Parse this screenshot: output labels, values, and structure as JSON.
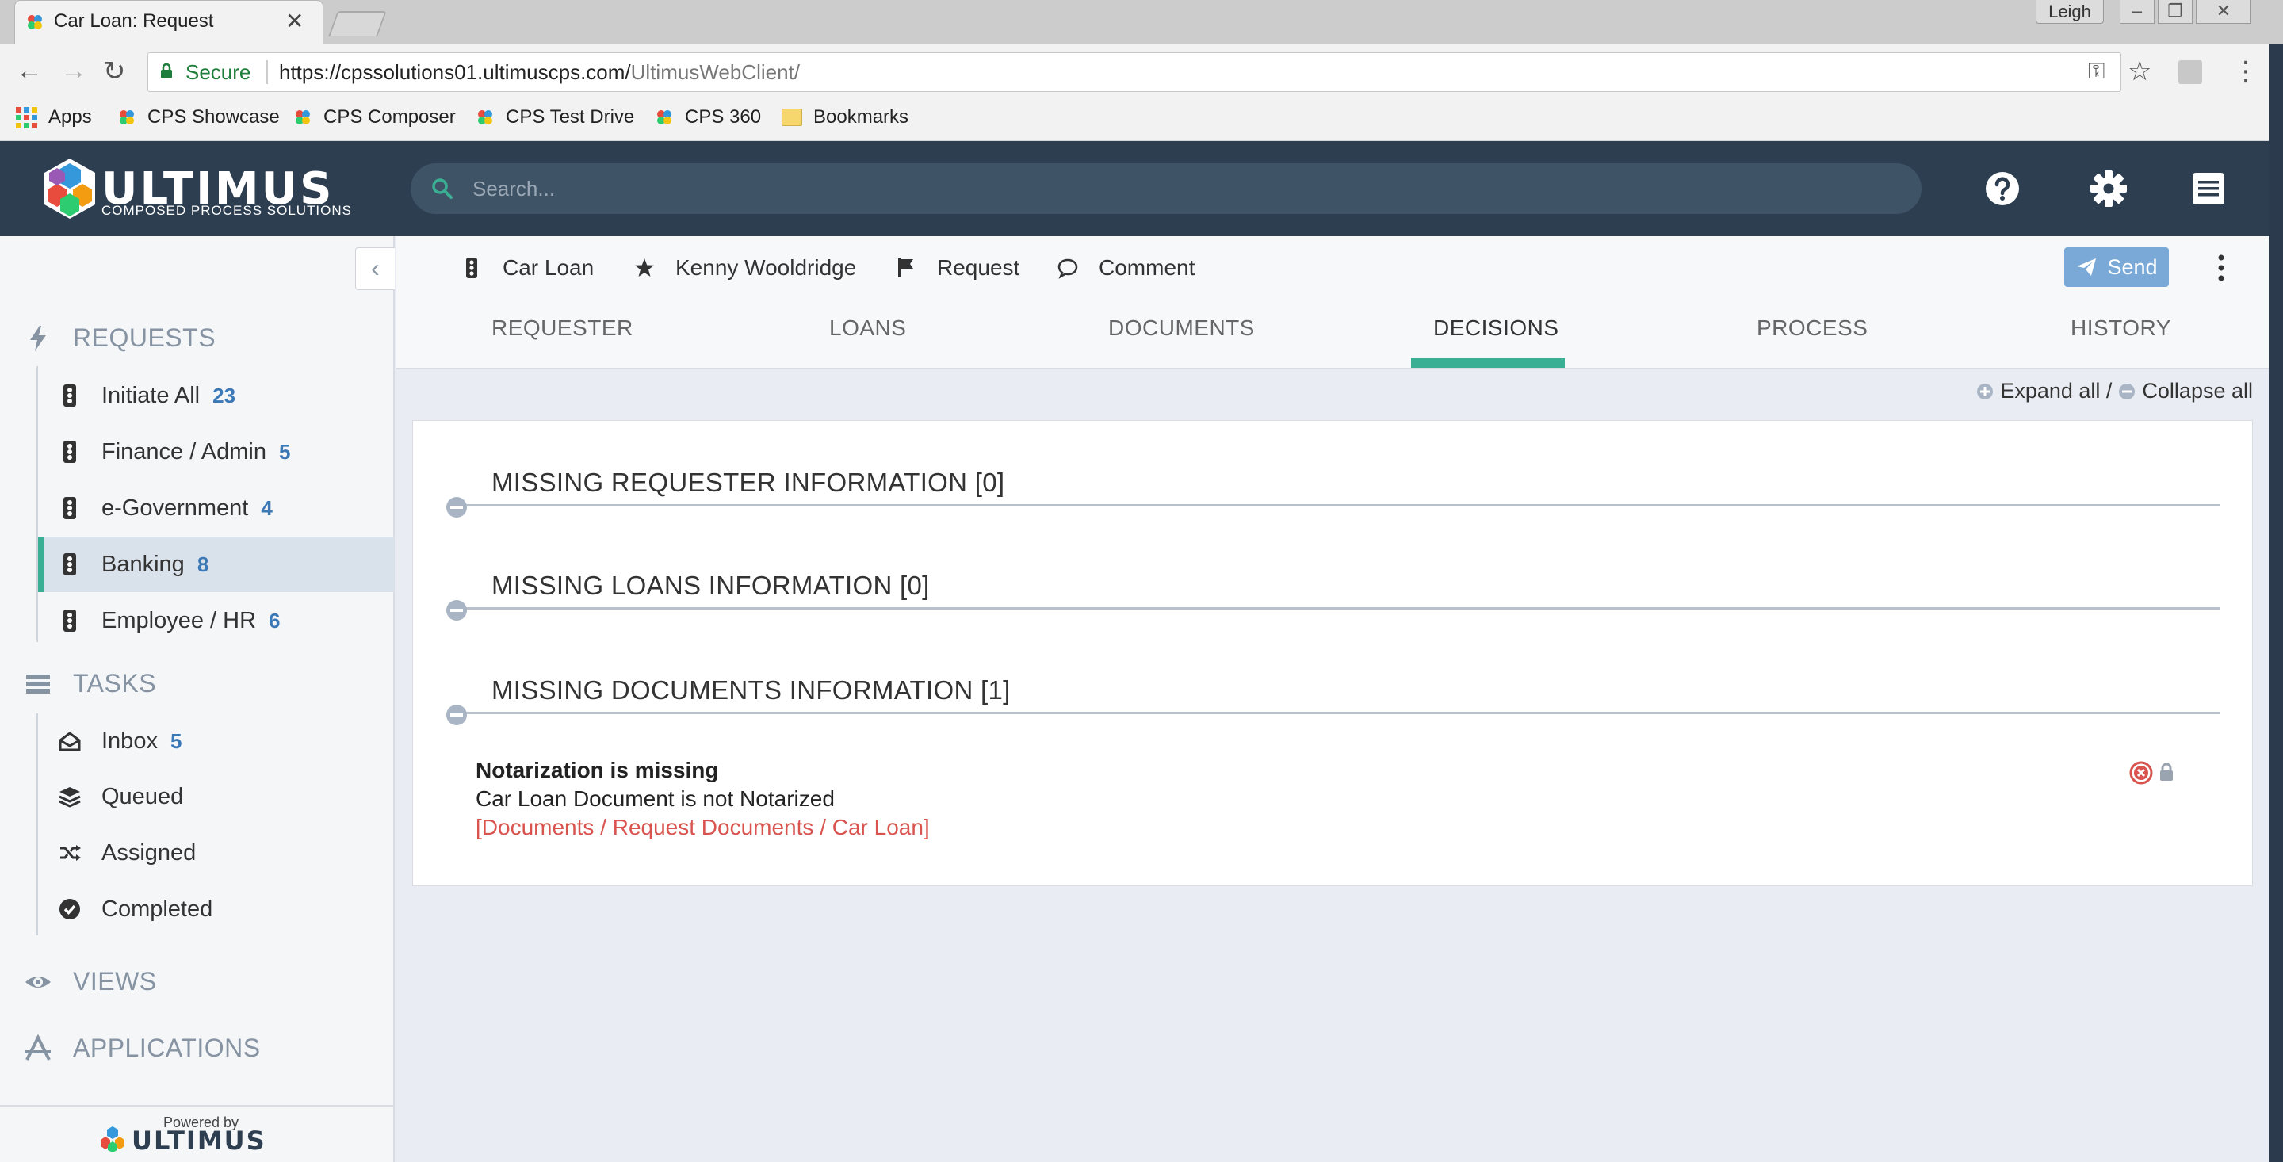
{
  "browser": {
    "tab_title": "Car Loan: Request",
    "user": "Leigh",
    "secure_label": "Secure",
    "url_host": "https://cpssolutions01.ultimuscps.com/",
    "url_path": "UltimusWebClient/",
    "bookmarks": [
      "Apps",
      "CPS Showcase",
      "CPS Composer",
      "CPS Test Drive",
      "CPS 360",
      "Bookmarks"
    ]
  },
  "header": {
    "logo_word": "ULTIMUS",
    "logo_tagline": "COMPOSED PROCESS SOLUTIONS",
    "search_placeholder": "Search..."
  },
  "sidebar": {
    "requests_label": "REQUESTS",
    "requests": [
      {
        "label": "Initiate All",
        "count": "23"
      },
      {
        "label": "Finance / Admin",
        "count": "5"
      },
      {
        "label": "e-Government",
        "count": "4"
      },
      {
        "label": "Banking",
        "count": "8"
      },
      {
        "label": "Employee / HR",
        "count": "6"
      }
    ],
    "tasks_label": "TASKS",
    "tasks": [
      {
        "label": "Inbox",
        "count": "5"
      },
      {
        "label": "Queued",
        "count": ""
      },
      {
        "label": "Assigned",
        "count": ""
      },
      {
        "label": "Completed",
        "count": ""
      }
    ],
    "views_label": "VIEWS",
    "applications_label": "APPLICATIONS",
    "powered_by": "Powered by",
    "powered_logo_word": "ULTIMUS"
  },
  "crumbs": {
    "form": "Car Loan",
    "user": "Kenny Wooldridge",
    "type": "Request",
    "comment": "Comment",
    "send": "Send"
  },
  "tabs": [
    "REQUESTER",
    "LOANS",
    "DOCUMENTS",
    "DECISIONS",
    "PROCESS",
    "HISTORY"
  ],
  "toggles": {
    "expand_all": "Expand all /",
    "collapse_all": "Collapse all"
  },
  "groups": [
    {
      "title": "MISSING REQUESTER INFORMATION [0]"
    },
    {
      "title": "MISSING LOANS INFORMATION [0]"
    },
    {
      "title": "MISSING DOCUMENTS INFORMATION [1]"
    }
  ],
  "issue": {
    "title": "Notarization is missing",
    "description": "Car Loan Document is not Notarized",
    "link": "[Documents / Request Documents / Car Loan]"
  },
  "colors": {
    "header_bg": "#2d3e50",
    "accent": "#3aaf93",
    "count_blue": "#3b78b6",
    "error_red": "#d9534f",
    "send_button": "#7aa9d8"
  }
}
